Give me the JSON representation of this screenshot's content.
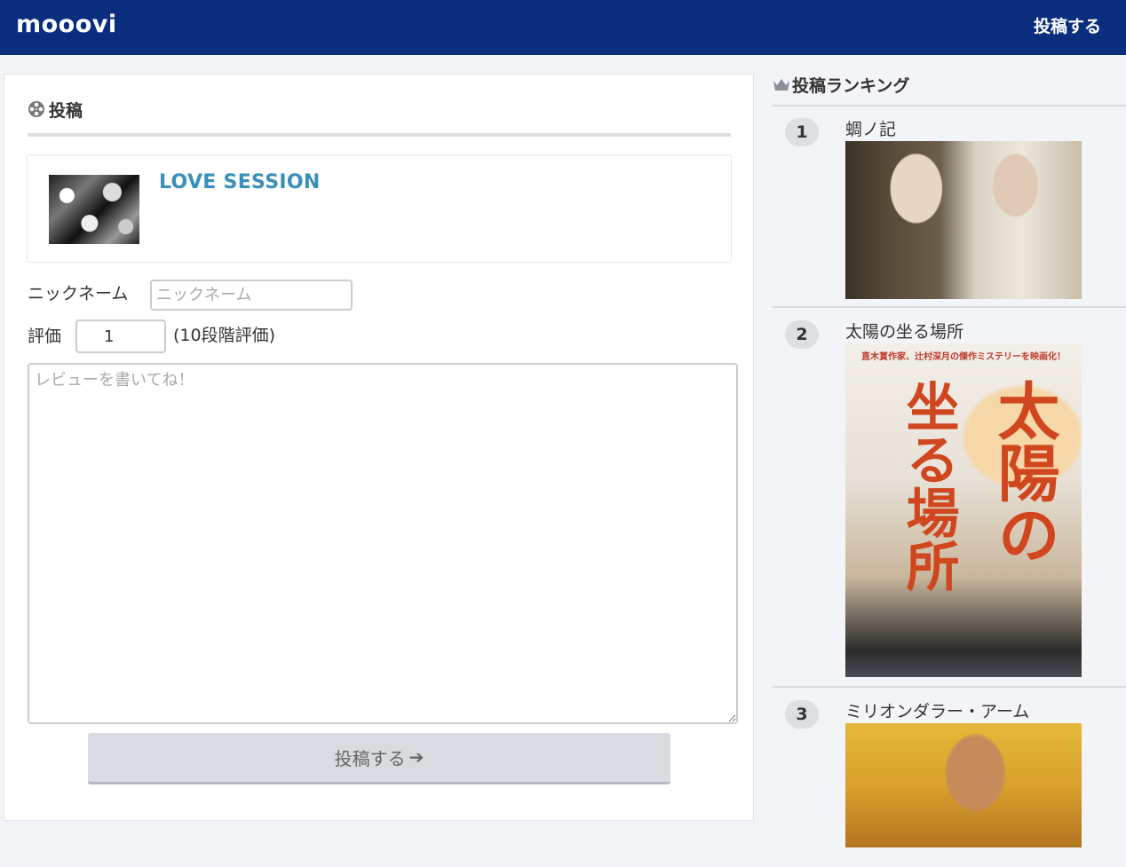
{
  "header": {
    "logo": "mooovi",
    "post_link": "投稿する"
  },
  "main": {
    "section_title": "投稿",
    "movie": {
      "title": "LOVE SESSION"
    },
    "form": {
      "nickname_label": "ニックネーム",
      "nickname_placeholder": "ニックネーム",
      "rating_label": "評価",
      "rating_value": "1",
      "rating_note": "(10段階評価)",
      "review_placeholder": "レビューを書いてね！",
      "submit_label": "投稿する",
      "submit_arrow": "➔"
    }
  },
  "sidebar": {
    "title": "投稿ランキング",
    "items": [
      {
        "rank": "1",
        "title": "蜩ノ記"
      },
      {
        "rank": "2",
        "title": "太陽の坐る場所",
        "poster_text": "直木賞作家、辻村深月の傑作ミステリーを映画化！",
        "poster_title_a": "太陽の",
        "poster_title_b": "坐る場所"
      },
      {
        "rank": "3",
        "title": "ミリオンダラー・アーム"
      }
    ]
  },
  "colors": {
    "header_bg": "#0a2e7d",
    "movie_title": "#3a8fbb"
  },
  "icons": {
    "section": "film-reel-icon",
    "ranking": "crown-icon",
    "submit": "arrow-right-icon"
  }
}
